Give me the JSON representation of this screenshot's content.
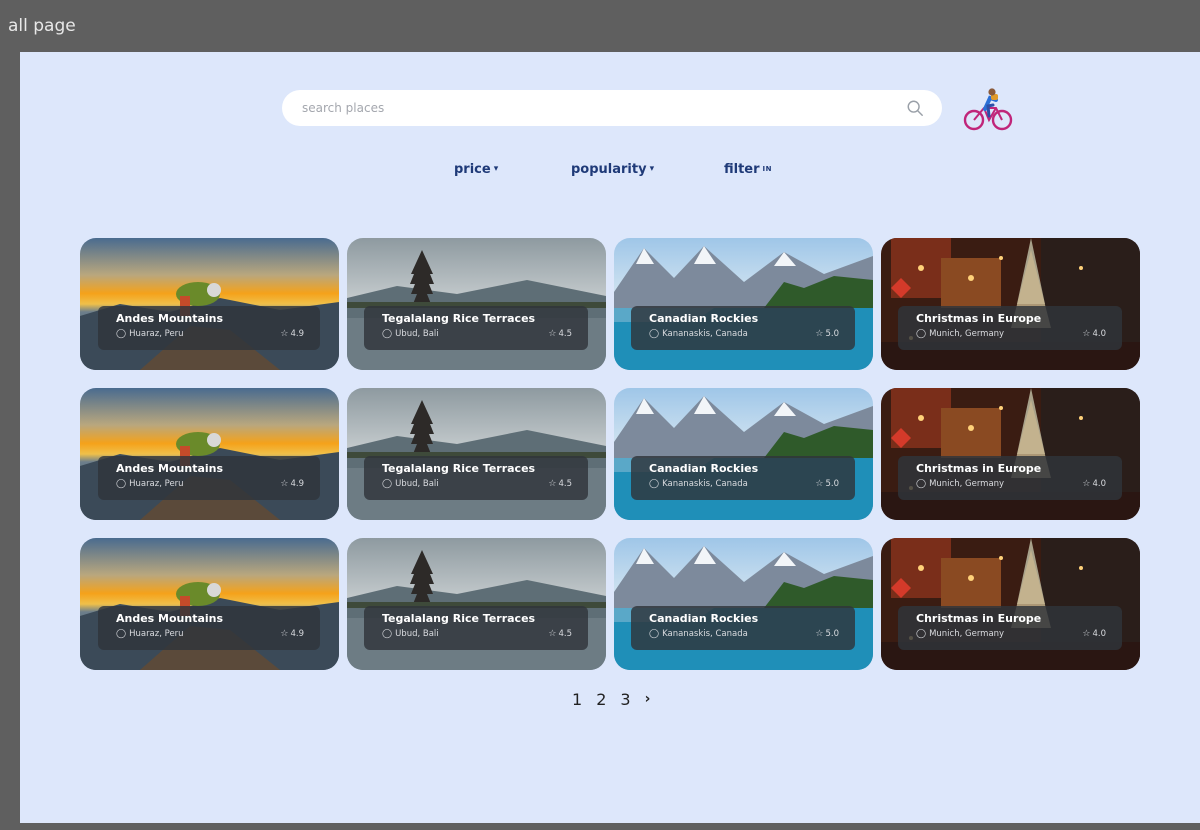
{
  "frame_label": "all page",
  "search": {
    "placeholder": "search places",
    "icon": "search-icon"
  },
  "avatar": {
    "icon": "cyclist-icon"
  },
  "filters": [
    {
      "label": "price",
      "indicator": "▾"
    },
    {
      "label": "popularity",
      "indicator": "▾"
    },
    {
      "label": "filter",
      "indicator": "IN"
    }
  ],
  "cards": [
    {
      "title": "Andes Mountains",
      "location": "Huaraz, Peru",
      "rating": "4.9",
      "scene": "andes"
    },
    {
      "title": "Tegalalang Rice Terraces",
      "location": "Ubud, Bali",
      "rating": "4.5",
      "scene": "bali"
    },
    {
      "title": "Canadian Rockies",
      "location": "Kananaskis, Canada",
      "rating": "5.0",
      "scene": "rockies"
    },
    {
      "title": "Christmas in Europe",
      "location": "Munich, Germany",
      "rating": "4.0",
      "scene": "europe"
    },
    {
      "title": "Andes Mountains",
      "location": "Huaraz, Peru",
      "rating": "4.9",
      "scene": "andes"
    },
    {
      "title": "Tegalalang Rice Terraces",
      "location": "Ubud, Bali",
      "rating": "4.5",
      "scene": "bali"
    },
    {
      "title": "Canadian Rockies",
      "location": "Kananaskis, Canada",
      "rating": "5.0",
      "scene": "rockies"
    },
    {
      "title": "Christmas in Europe",
      "location": "Munich, Germany",
      "rating": "4.0",
      "scene": "europe"
    },
    {
      "title": "Andes Mountains",
      "location": "Huaraz, Peru",
      "rating": "4.9",
      "scene": "andes"
    },
    {
      "title": "Tegalalang Rice Terraces",
      "location": "Ubud, Bali",
      "rating": "4.5",
      "scene": "bali"
    },
    {
      "title": "Canadian Rockies",
      "location": "Kananaskis, Canada",
      "rating": "5.0",
      "scene": "rockies"
    },
    {
      "title": "Christmas in Europe",
      "location": "Munich, Germany",
      "rating": "4.0",
      "scene": "europe"
    }
  ],
  "pagination": {
    "pages": [
      "1",
      "2",
      "3"
    ],
    "next": "›"
  },
  "colors": {
    "background": "#dde7fb",
    "accent": "#1f3a78",
    "frame": "#5f5f5f"
  }
}
